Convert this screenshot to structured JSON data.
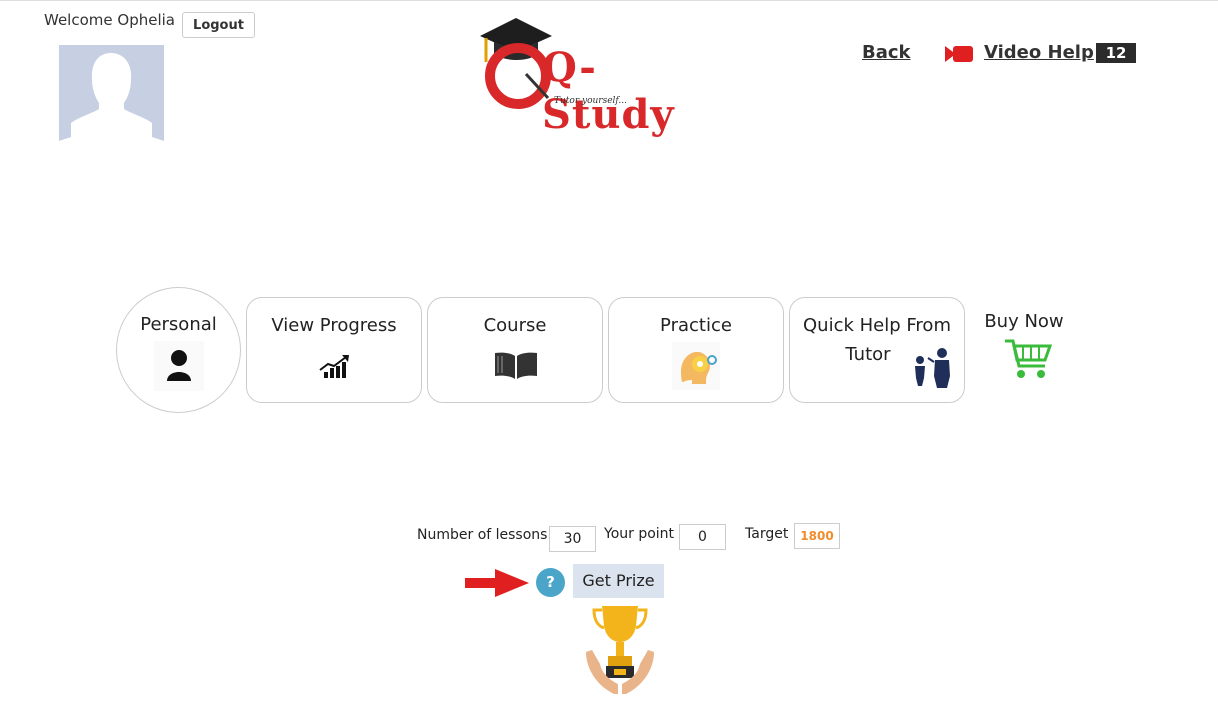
{
  "user": {
    "welcome_text": "Welcome Ophelia",
    "logout_label": "Logout"
  },
  "logo": {
    "title": "Q-Study",
    "tagline": "Tutor yourself..."
  },
  "header": {
    "back_label": "Back",
    "video_help_label": "Video Help",
    "video_count": "12"
  },
  "nav": {
    "personal": "Personal",
    "view_progress": "View Progress",
    "course": "Course",
    "practice": "Practice",
    "quick_help_line1": "Quick Help From",
    "quick_help_line2": "Tutor",
    "buy_now": "Buy Now"
  },
  "stats": {
    "lessons_label": "Number of lessons",
    "lessons_value": "30",
    "point_label": "Your point",
    "point_value": "0",
    "target_label": "Target",
    "target_value": "1800"
  },
  "prize": {
    "help_symbol": "?",
    "button_label": "Get Prize"
  },
  "icons": [
    "user-icon",
    "chart-up-icon",
    "book-icon",
    "idea-gear-icon",
    "tutor-icon",
    "cart-icon",
    "video-camera-icon",
    "trophy-icon",
    "arrow-right-icon"
  ],
  "colors": {
    "brand_red": "#d8282a",
    "target_orange": "#f08c2c",
    "help_blue": "#4aa5c9",
    "cart_green": "#3bbb3b",
    "prize_bg": "#dbe3ee"
  }
}
